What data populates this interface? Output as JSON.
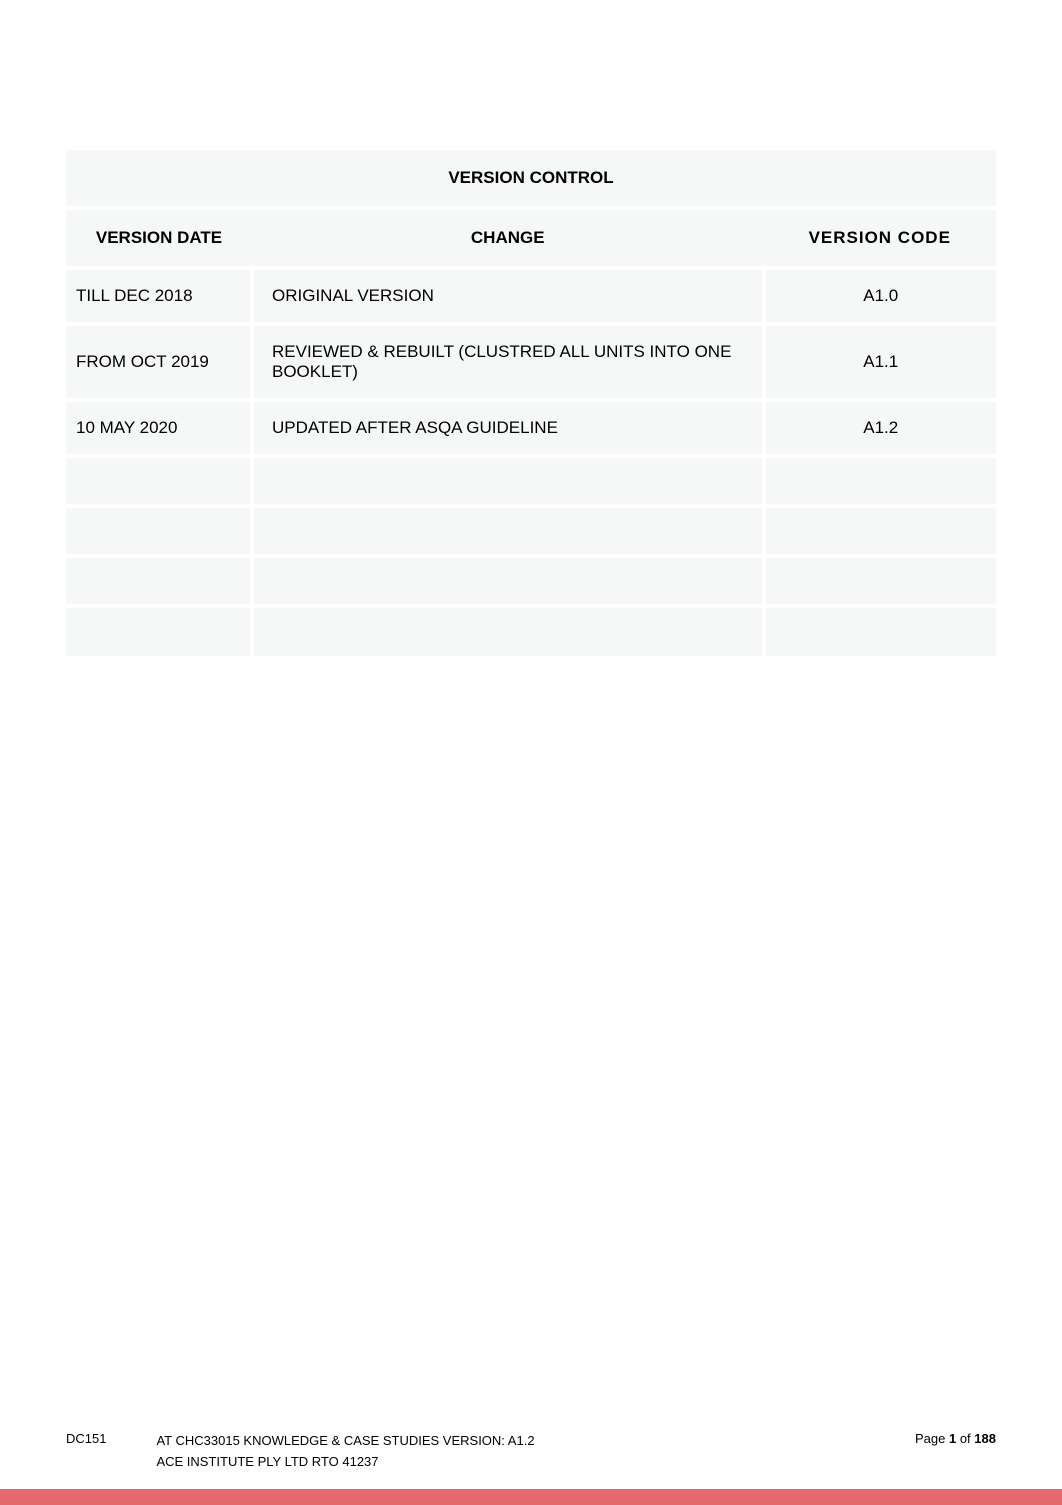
{
  "table": {
    "title": "VERSION CONTROL",
    "headers": {
      "date": "VERSION DATE",
      "change": "CHANGE",
      "code": "VERSION  CODE"
    },
    "rows": [
      {
        "date": "TILL DEC 2018",
        "change": "ORIGINAL VERSION",
        "code": "A1.0"
      },
      {
        "date": "FROM OCT 2019",
        "change": "REVIEWED & REBUILT (CLUSTRED ALL UNITS INTO ONE BOOKLET)",
        "code": "A1.1"
      },
      {
        "date": "10 MAY 2020",
        "change": "UPDATED AFTER ASQA GUIDELINE",
        "code": "A1.2"
      }
    ]
  },
  "footer": {
    "doc_code": "DC151",
    "line1": "AT CHC33015 KNOWLEDGE & CASE STUDIES VERSION: A1.2",
    "line2": "ACE INSTITUTE PLY LTD RTO 41237",
    "page_label": "Page ",
    "page_current": "1",
    "page_of": " of ",
    "page_total": "188"
  }
}
